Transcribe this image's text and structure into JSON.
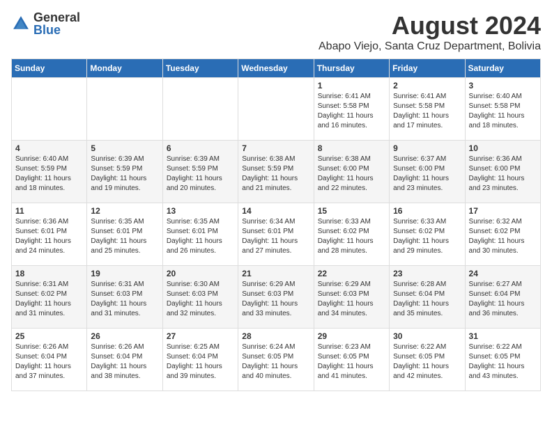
{
  "logo": {
    "general": "General",
    "blue": "Blue"
  },
  "title": {
    "month_year": "August 2024",
    "location": "Abapo Viejo, Santa Cruz Department, Bolivia"
  },
  "calendar": {
    "headers": [
      "Sunday",
      "Monday",
      "Tuesday",
      "Wednesday",
      "Thursday",
      "Friday",
      "Saturday"
    ],
    "weeks": [
      [
        {
          "day": "",
          "content": ""
        },
        {
          "day": "",
          "content": ""
        },
        {
          "day": "",
          "content": ""
        },
        {
          "day": "",
          "content": ""
        },
        {
          "day": "1",
          "content": "Sunrise: 6:41 AM\nSunset: 5:58 PM\nDaylight: 11 hours and 16 minutes."
        },
        {
          "day": "2",
          "content": "Sunrise: 6:41 AM\nSunset: 5:58 PM\nDaylight: 11 hours and 17 minutes."
        },
        {
          "day": "3",
          "content": "Sunrise: 6:40 AM\nSunset: 5:58 PM\nDaylight: 11 hours and 18 minutes."
        }
      ],
      [
        {
          "day": "4",
          "content": "Sunrise: 6:40 AM\nSunset: 5:59 PM\nDaylight: 11 hours and 18 minutes."
        },
        {
          "day": "5",
          "content": "Sunrise: 6:39 AM\nSunset: 5:59 PM\nDaylight: 11 hours and 19 minutes."
        },
        {
          "day": "6",
          "content": "Sunrise: 6:39 AM\nSunset: 5:59 PM\nDaylight: 11 hours and 20 minutes."
        },
        {
          "day": "7",
          "content": "Sunrise: 6:38 AM\nSunset: 5:59 PM\nDaylight: 11 hours and 21 minutes."
        },
        {
          "day": "8",
          "content": "Sunrise: 6:38 AM\nSunset: 6:00 PM\nDaylight: 11 hours and 22 minutes."
        },
        {
          "day": "9",
          "content": "Sunrise: 6:37 AM\nSunset: 6:00 PM\nDaylight: 11 hours and 23 minutes."
        },
        {
          "day": "10",
          "content": "Sunrise: 6:36 AM\nSunset: 6:00 PM\nDaylight: 11 hours and 23 minutes."
        }
      ],
      [
        {
          "day": "11",
          "content": "Sunrise: 6:36 AM\nSunset: 6:01 PM\nDaylight: 11 hours and 24 minutes."
        },
        {
          "day": "12",
          "content": "Sunrise: 6:35 AM\nSunset: 6:01 PM\nDaylight: 11 hours and 25 minutes."
        },
        {
          "day": "13",
          "content": "Sunrise: 6:35 AM\nSunset: 6:01 PM\nDaylight: 11 hours and 26 minutes."
        },
        {
          "day": "14",
          "content": "Sunrise: 6:34 AM\nSunset: 6:01 PM\nDaylight: 11 hours and 27 minutes."
        },
        {
          "day": "15",
          "content": "Sunrise: 6:33 AM\nSunset: 6:02 PM\nDaylight: 11 hours and 28 minutes."
        },
        {
          "day": "16",
          "content": "Sunrise: 6:33 AM\nSunset: 6:02 PM\nDaylight: 11 hours and 29 minutes."
        },
        {
          "day": "17",
          "content": "Sunrise: 6:32 AM\nSunset: 6:02 PM\nDaylight: 11 hours and 30 minutes."
        }
      ],
      [
        {
          "day": "18",
          "content": "Sunrise: 6:31 AM\nSunset: 6:02 PM\nDaylight: 11 hours and 31 minutes."
        },
        {
          "day": "19",
          "content": "Sunrise: 6:31 AM\nSunset: 6:03 PM\nDaylight: 11 hours and 31 minutes."
        },
        {
          "day": "20",
          "content": "Sunrise: 6:30 AM\nSunset: 6:03 PM\nDaylight: 11 hours and 32 minutes."
        },
        {
          "day": "21",
          "content": "Sunrise: 6:29 AM\nSunset: 6:03 PM\nDaylight: 11 hours and 33 minutes."
        },
        {
          "day": "22",
          "content": "Sunrise: 6:29 AM\nSunset: 6:03 PM\nDaylight: 11 hours and 34 minutes."
        },
        {
          "day": "23",
          "content": "Sunrise: 6:28 AM\nSunset: 6:04 PM\nDaylight: 11 hours and 35 minutes."
        },
        {
          "day": "24",
          "content": "Sunrise: 6:27 AM\nSunset: 6:04 PM\nDaylight: 11 hours and 36 minutes."
        }
      ],
      [
        {
          "day": "25",
          "content": "Sunrise: 6:26 AM\nSunset: 6:04 PM\nDaylight: 11 hours and 37 minutes."
        },
        {
          "day": "26",
          "content": "Sunrise: 6:26 AM\nSunset: 6:04 PM\nDaylight: 11 hours and 38 minutes."
        },
        {
          "day": "27",
          "content": "Sunrise: 6:25 AM\nSunset: 6:04 PM\nDaylight: 11 hours and 39 minutes."
        },
        {
          "day": "28",
          "content": "Sunrise: 6:24 AM\nSunset: 6:05 PM\nDaylight: 11 hours and 40 minutes."
        },
        {
          "day": "29",
          "content": "Sunrise: 6:23 AM\nSunset: 6:05 PM\nDaylight: 11 hours and 41 minutes."
        },
        {
          "day": "30",
          "content": "Sunrise: 6:22 AM\nSunset: 6:05 PM\nDaylight: 11 hours and 42 minutes."
        },
        {
          "day": "31",
          "content": "Sunrise: 6:22 AM\nSunset: 6:05 PM\nDaylight: 11 hours and 43 minutes."
        }
      ]
    ]
  }
}
